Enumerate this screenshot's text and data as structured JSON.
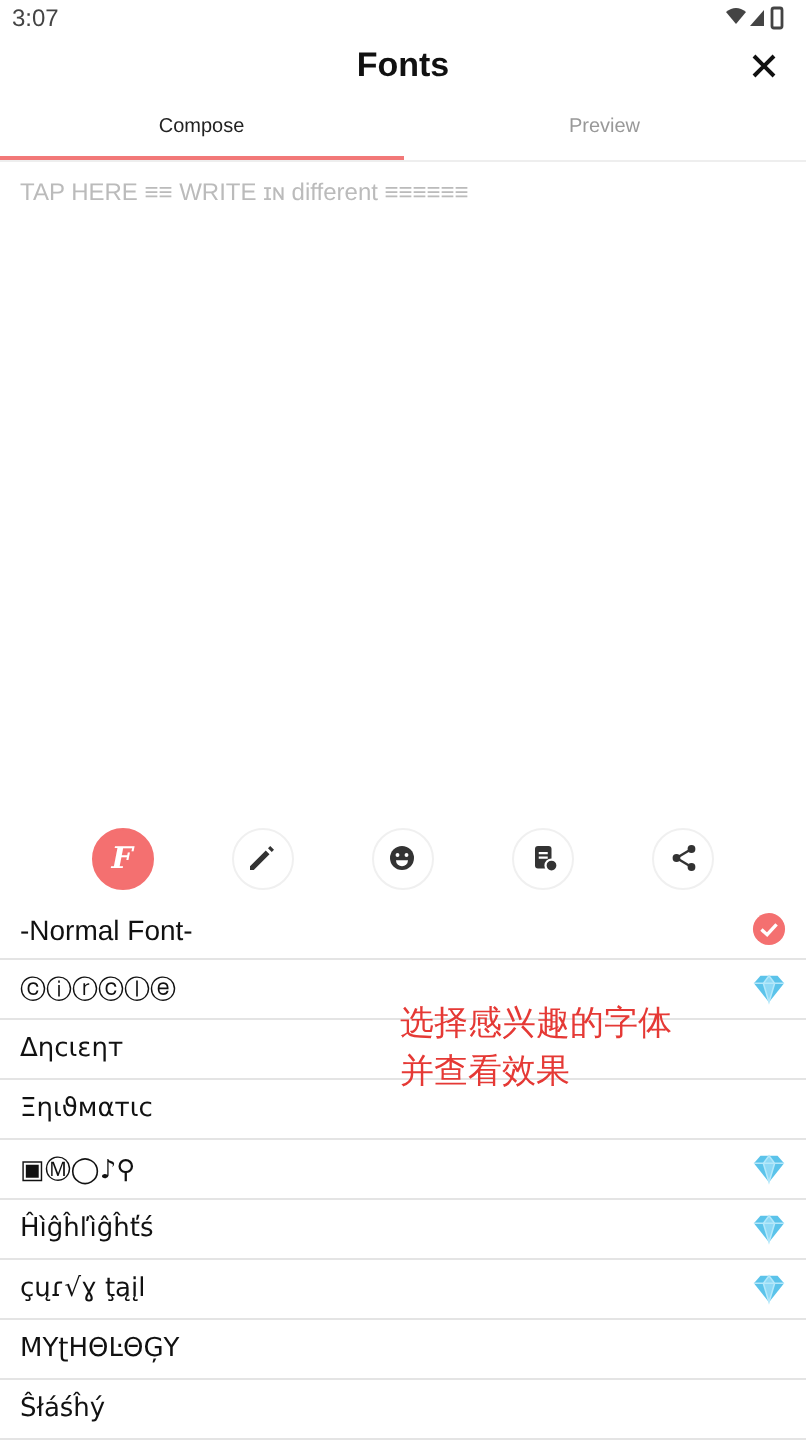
{
  "status_bar": {
    "time": "3:07"
  },
  "header": {
    "title": "Fonts"
  },
  "tabs": [
    {
      "label": "Compose",
      "selected": true
    },
    {
      "label": "Preview",
      "selected": false
    }
  ],
  "editor": {
    "placeholder": "TAP HERE ≡≡ WRITE ɪɴ different ≡≡≡≡≡≡"
  },
  "toolbar": [
    {
      "kind": "font",
      "selected": true,
      "glyph": "F"
    },
    {
      "kind": "pen",
      "selected": false
    },
    {
      "kind": "emoji",
      "selected": false
    },
    {
      "kind": "saved",
      "selected": false
    },
    {
      "kind": "share",
      "selected": false
    }
  ],
  "fonts": [
    {
      "name": "-Normal Font-",
      "selected": true
    },
    {
      "name": "ⓒⓘⓡⓒⓛⓔ",
      "selected": false,
      "premium": true
    },
    {
      "name": "Δηcιεηт",
      "selected": false,
      "premium": false
    },
    {
      "name": "Ξηιϑмαтιc",
      "selected": false,
      "premium": false
    },
    {
      "name": "▣Ⓜ◯♪⚲",
      "selected": false,
      "premium": true
    },
    {
      "name": "Ĥìĝĥľìĝĥťś",
      "selected": false,
      "premium": true
    },
    {
      "name": "çųɾ√ɣ ţąįl",
      "selected": false,
      "premium": true
    },
    {
      "name": "ΜΥʈΗΘĿΘĢΥ",
      "selected": false,
      "premium": false
    },
    {
      "name": "Ŝłáśĥý",
      "selected": false,
      "premium": false
    }
  ],
  "annotation": {
    "lines": [
      "选择感兴趣的字体",
      "并查看效果"
    ]
  }
}
